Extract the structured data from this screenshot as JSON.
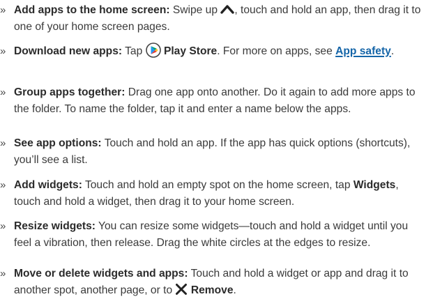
{
  "bullet": "»",
  "items": [
    {
      "term": "Add apps to the home screen:",
      "text1": " Swipe up ",
      "icon1": "chevron-up-icon",
      "text2": ", touch and hold an app, then drag it to one of your home screen pages."
    },
    {
      "term": "Download new apps:",
      "text1": " Tap ",
      "icon1": "play-store-icon",
      "bold1": " Play Store",
      "text2": ". For more on apps, see ",
      "link1": "App safety",
      "text3": "."
    },
    {
      "term": "Group apps together:",
      "text1": " Drag one app onto another. Do it again to add more apps to the folder. To name the folder, tap it and enter a name below the apps."
    },
    {
      "term": "See app options:",
      "text1": " Touch and hold an app. If the app has quick options (shortcuts), you’ll see a list."
    },
    {
      "term": "Add widgets:",
      "text1": " Touch and hold an empty spot on the home screen, tap ",
      "bold1": "Widgets",
      "text2": ", touch and hold a widget, then drag it to your home screen."
    },
    {
      "term": "Resize widgets:",
      "text1": " You can resize some widgets—touch and hold a widget until you feel a vibration, then release. Drag the white circles at the edges to resize."
    },
    {
      "term": "Move or delete widgets and apps:",
      "text1": " Touch and hold a widget or app and drag it to another spot, another page, or to ",
      "icon1": "close-x-icon",
      "bold1": " Remove",
      "text2": "."
    }
  ],
  "colors": {
    "text": "#3a3a3a",
    "link": "#1565a8",
    "play_green": "#00a173",
    "play_blue": "#2196f3",
    "play_yellow": "#fbc02d",
    "play_red": "#e53935"
  }
}
